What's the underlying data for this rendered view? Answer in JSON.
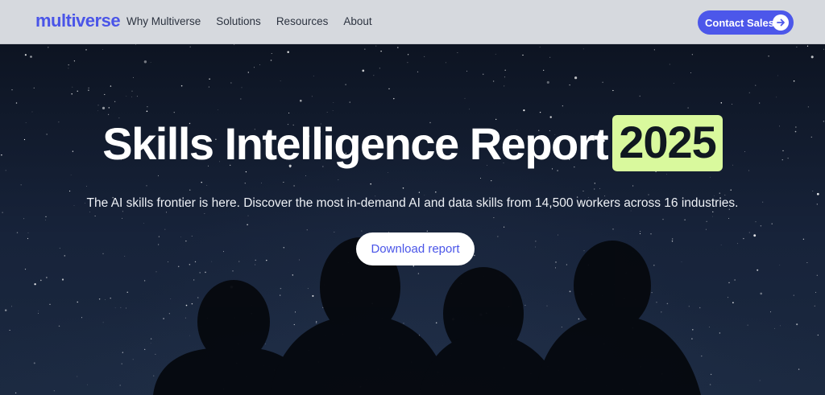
{
  "header": {
    "logo": "multiverse",
    "nav": [
      {
        "label": "Why Multiverse"
      },
      {
        "label": "Solutions"
      },
      {
        "label": "Resources"
      },
      {
        "label": "About"
      }
    ],
    "contact_label": "Contact Sales",
    "contact_icon": "arrow-right-icon"
  },
  "hero": {
    "title": "Skills Intelligence Report",
    "year": "2025",
    "subtitle": "The AI skills frontier is here. Discover the most in-demand AI and data skills from 14,500 workers across 16 industries.",
    "cta_label": "Download report"
  },
  "colors": {
    "brand": "#4c57ea",
    "highlight": "#d9f99d",
    "header_bg": "#d6d9de",
    "sky": "#17233a"
  }
}
